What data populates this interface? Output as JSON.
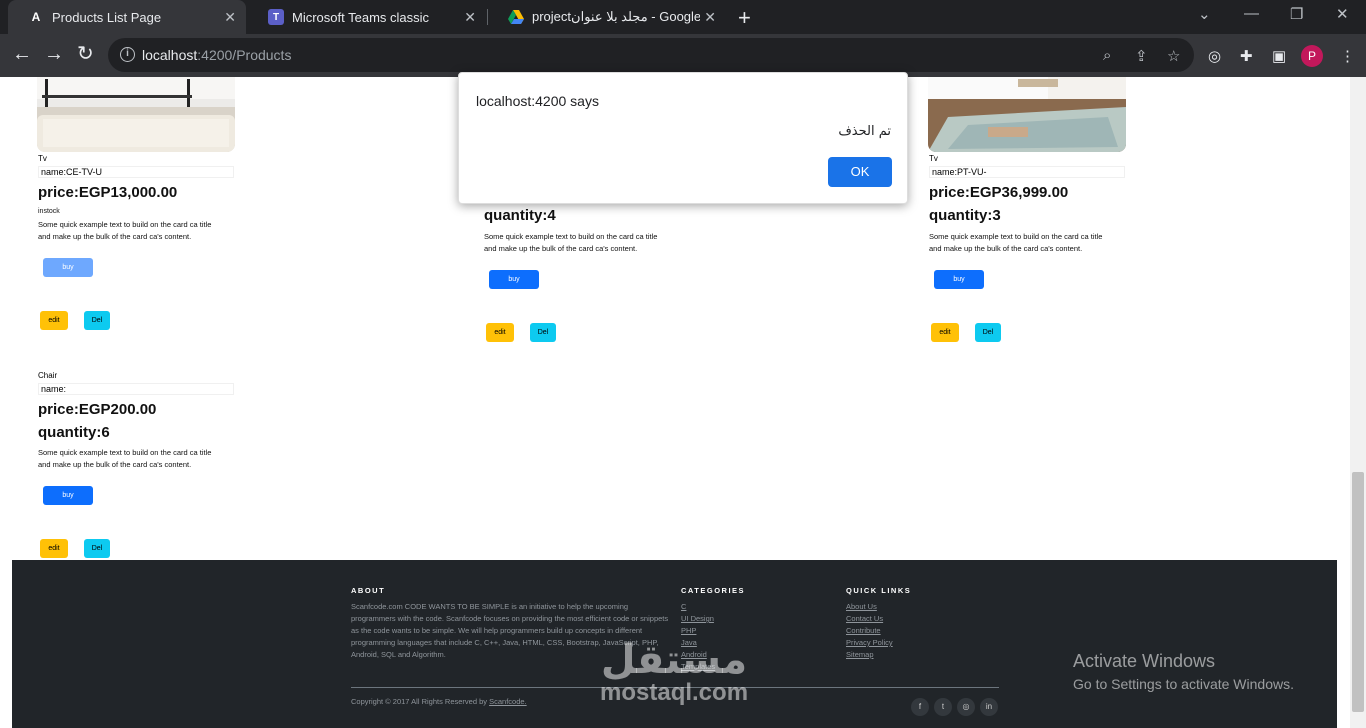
{
  "browser": {
    "tabs": [
      {
        "title": "Products List Page",
        "favicon": "angular-icon"
      },
      {
        "title": "Microsoft Teams classic",
        "favicon": "teams-icon"
      },
      {
        "title": "projectمجلد بلا عنوان - Google Dr",
        "favicon": "drive-icon"
      }
    ],
    "url_host": "localhost",
    "url_path": ":4200/Products",
    "profile_initial": "P"
  },
  "products": [
    {
      "category": "Tv",
      "name": "name:CE-TV-U",
      "price": "price:EGP13,000.00",
      "stock": "instock",
      "desc_line1": "Some quick example text to build on the card ca title",
      "desc_line2": "and make up the bulk of the card ca's content.",
      "buy": "buy",
      "edit": "edit",
      "del": "Del"
    },
    {
      "quantity": "quantity:4",
      "desc_line1": "Some quick example text to build on the card ca title",
      "desc_line2": "and make up the bulk of the card ca's content.",
      "buy": "buy",
      "edit": "edit",
      "del": "Del"
    },
    {
      "category": "Tv",
      "name": "name:PT-VU-",
      "price": "price:EGP36,999.00",
      "quantity": "quantity:3",
      "desc_line1": "Some quick example text to build on the card ca title",
      "desc_line2": "and make up the bulk of the card ca's content.",
      "buy": "buy",
      "edit": "edit",
      "del": "Del"
    },
    {
      "category": "Chair",
      "name": "name:",
      "price": "price:EGP200.00",
      "quantity": "quantity:6",
      "desc_line1": "Some quick example text to build on the card ca title",
      "desc_line2": "and make up the bulk of the card ca's content.",
      "buy": "buy",
      "edit": "edit",
      "del": "Del"
    }
  ],
  "footer": {
    "about_heading": "ABOUT",
    "about_text": "Scanfcode.com CODE WANTS TO BE SIMPLE is an initiative to help the upcoming programmers with the code. Scanfcode focuses on providing the most efficient code or snippets as the code wants to be simple. We will help programmers build up concepts in different programming languages that include C, C++, Java, HTML, CSS, Bootstrap, JavaScript, PHP, Android, SQL and Algorithm.",
    "categories_heading": "CATEGORIES",
    "categories": [
      "C",
      "UI Design",
      "PHP",
      "Java",
      "Android",
      "Templates"
    ],
    "quicklinks_heading": "QUICK LINKS",
    "quicklinks": [
      "About Us",
      "Contact Us",
      "Contribute",
      "Privacy Policy",
      "Sitemap"
    ],
    "copyright": "Copyright © 2017 All Rights Reserved by",
    "copyright_link": "Scanfcode."
  },
  "dialog": {
    "title": "localhost:4200 says",
    "message": "تم الحذف",
    "ok": "OK"
  },
  "overlay": {
    "activate_line1": "Activate Windows",
    "activate_line2": "Go to Settings to activate Windows.",
    "watermark_ar": "مستقل",
    "watermark_en": "mostaql.com"
  }
}
